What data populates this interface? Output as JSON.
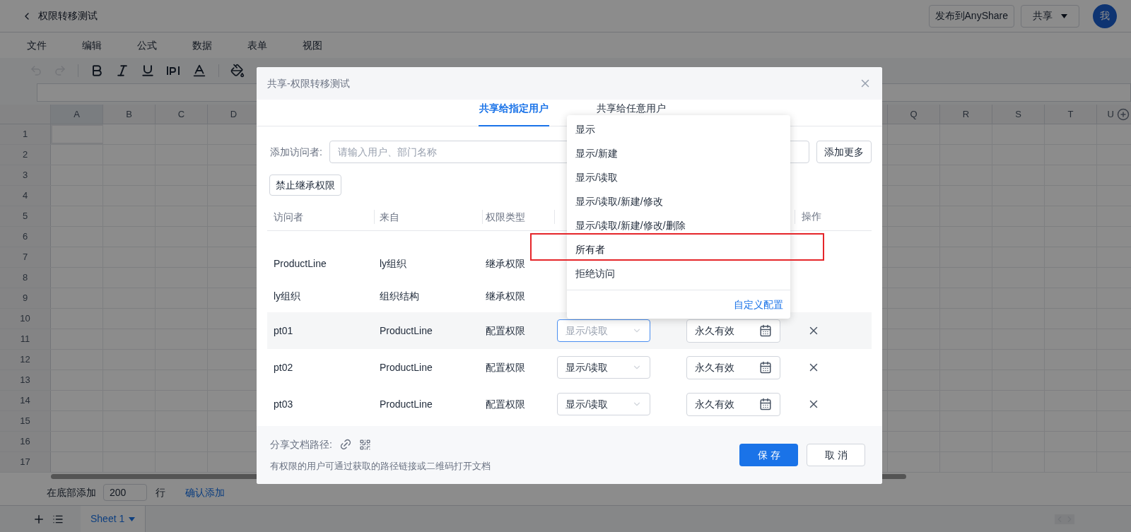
{
  "header": {
    "title": "权限转移测试",
    "publish_button": "发布到AnyShare",
    "share_button": "共享",
    "avatar": "我"
  },
  "menu": [
    "文件",
    "编辑",
    "公式",
    "数据",
    "表单",
    "视图"
  ],
  "grid": {
    "columns_left": [
      "A",
      "B",
      "C",
      "D"
    ],
    "columns_right": [
      "Q",
      "R",
      "S",
      "T",
      "U"
    ],
    "rows": [
      "1",
      "2",
      "3",
      "4",
      "5",
      "6",
      "7",
      "8",
      "9",
      "10",
      "11",
      "12",
      "13",
      "14",
      "15",
      "16",
      "17"
    ]
  },
  "bottom_bar": {
    "label": "在底部添加",
    "count": "200",
    "unit": "行",
    "confirm": "确认添加"
  },
  "sheet_tabs": [
    {
      "label": "Sheet 1",
      "selected": true
    }
  ],
  "dialog": {
    "title": "共享-权限转移测试",
    "tabs": [
      {
        "label": "共享给指定用户",
        "selected": true
      },
      {
        "label": "共享给任意用户",
        "selected": false
      }
    ],
    "add_label": "添加访问者:",
    "add_placeholder": "请输入用户、部门名称",
    "add_more": "添加更多",
    "stop_inherit": "禁止继承权限",
    "columns": {
      "visitor": "访问者",
      "source": "来自",
      "type": "权限类型",
      "action": "操作"
    },
    "rows": [
      {
        "kind": "inherited",
        "visitor": "ProductLine",
        "source": "ly组织",
        "type": "继承权限"
      },
      {
        "kind": "inherited",
        "visitor": "ly组织",
        "source": "组织结构",
        "type": "继承权限"
      },
      {
        "kind": "configured",
        "visitor": "pt01",
        "source": "ProductLine",
        "type": "配置权限",
        "permission": "显示/读取",
        "validity": "永久有效",
        "active": true
      },
      {
        "kind": "configured",
        "visitor": "pt02",
        "source": "ProductLine",
        "type": "配置权限",
        "permission": "显示/读取",
        "validity": "永久有效",
        "active": false
      },
      {
        "kind": "configured",
        "visitor": "pt03",
        "source": "ProductLine",
        "type": "配置权限",
        "permission": "显示/读取",
        "validity": "永久有效",
        "active": false
      }
    ],
    "path_label": "分享文档路径:",
    "note": "有权限的用户可通过获取的路径链接或二维码打开文档",
    "save": "保存",
    "cancel": "取消"
  },
  "permission_menu": {
    "options": [
      {
        "label": "显示",
        "highlighted": false
      },
      {
        "label": "显示/新建",
        "highlighted": false
      },
      {
        "label": "显示/读取",
        "highlighted": false
      },
      {
        "label": "显示/读取/新建/修改",
        "highlighted": false
      },
      {
        "label": "显示/读取/新建/修改/删除",
        "highlighted": false
      },
      {
        "label": "所有者",
        "highlighted": true
      },
      {
        "label": "拒绝访问",
        "highlighted": false
      }
    ],
    "custom": "自定义配置"
  }
}
